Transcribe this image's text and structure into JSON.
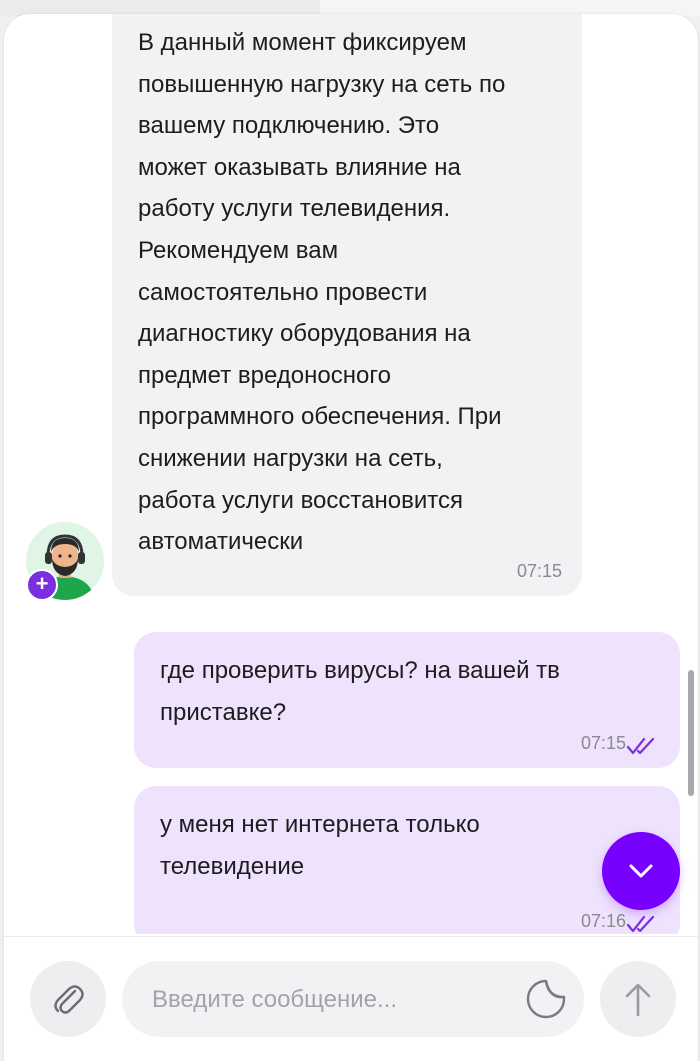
{
  "messages": [
    {
      "sender": "operator",
      "text": "В данный момент фиксируем\nповышенную нагрузку на сеть по\nвашему подключению. Это\nможет оказывать влияние на\nработу услуги телевидения.\nРекомендуем вам\nсамостоятельно провести\nдиагностику оборудования на\nпредмет вредоносного\nпрограммного обеспечения. При\nснижении нагрузки на сеть,\nработа услуги восстановится\nавтоматически",
      "time": "07:15"
    },
    {
      "sender": "me",
      "text": "где проверить вирусы? на вашей тв\nприставке?",
      "time": "07:15",
      "status": "read"
    },
    {
      "sender": "me",
      "text": "у меня нет интернета только\nтелевидение",
      "time": "07:16",
      "status": "read"
    }
  ],
  "avatar": {
    "icon": "operator-avatar-icon",
    "badge_symbol": "+"
  },
  "composer": {
    "placeholder": "Введите сообщение...",
    "value": ""
  },
  "icons": {
    "attach": "paperclip-icon",
    "sticker": "sticker-icon",
    "send": "arrow-up-icon",
    "scroll_down": "chevron-down-icon",
    "read_status": "double-check-icon"
  },
  "colors": {
    "accent": "#7700ff",
    "my_bubble": "#efe2fd",
    "operator_bubble": "#f2f2f4",
    "checks": "#7b2fe0"
  }
}
